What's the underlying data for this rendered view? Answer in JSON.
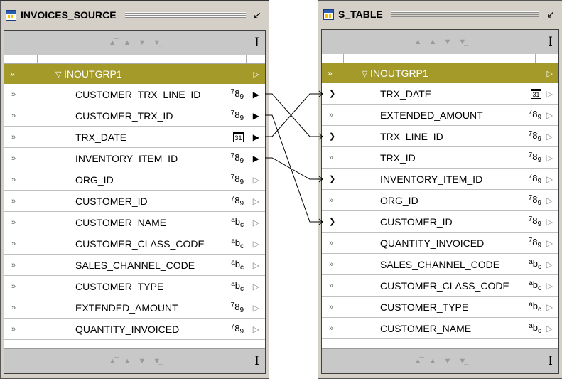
{
  "left": {
    "title": "INVOICES_SOURCE",
    "group": "INOUTGRP1",
    "rows": [
      {
        "name": "CUSTOMER_TRX_LINE_ID",
        "type": "num",
        "linked": true
      },
      {
        "name": "CUSTOMER_TRX_ID",
        "type": "num",
        "linked": true
      },
      {
        "name": "TRX_DATE",
        "type": "date",
        "linked": true
      },
      {
        "name": "INVENTORY_ITEM_ID",
        "type": "num",
        "linked": true
      },
      {
        "name": "ORG_ID",
        "type": "num",
        "linked": false
      },
      {
        "name": "CUSTOMER_ID",
        "type": "num",
        "linked": false
      },
      {
        "name": "CUSTOMER_NAME",
        "type": "str",
        "linked": false
      },
      {
        "name": "CUSTOMER_CLASS_CODE",
        "type": "str",
        "linked": false
      },
      {
        "name": "SALES_CHANNEL_CODE",
        "type": "str",
        "linked": false
      },
      {
        "name": "CUSTOMER_TYPE",
        "type": "str",
        "linked": false
      },
      {
        "name": "EXTENDED_AMOUNT",
        "type": "num",
        "linked": false
      },
      {
        "name": "QUANTITY_INVOICED",
        "type": "num",
        "linked": false
      }
    ]
  },
  "right": {
    "title": "S_TABLE",
    "group": "INOUTGRP1",
    "rows": [
      {
        "name": "TRX_DATE",
        "type": "date",
        "linked": true
      },
      {
        "name": "EXTENDED_AMOUNT",
        "type": "num",
        "linked": false
      },
      {
        "name": "TRX_LINE_ID",
        "type": "num",
        "linked": true
      },
      {
        "name": "TRX_ID",
        "type": "num",
        "linked": false
      },
      {
        "name": "INVENTORY_ITEM_ID",
        "type": "num",
        "linked": true
      },
      {
        "name": "ORG_ID",
        "type": "num",
        "linked": false
      },
      {
        "name": "CUSTOMER_ID",
        "type": "num",
        "linked": true
      },
      {
        "name": "QUANTITY_INVOICED",
        "type": "num",
        "linked": false
      },
      {
        "name": "SALES_CHANNEL_CODE",
        "type": "str",
        "linked": false
      },
      {
        "name": "CUSTOMER_CLASS_CODE",
        "type": "str",
        "linked": false
      },
      {
        "name": "CUSTOMER_TYPE",
        "type": "str",
        "linked": false
      },
      {
        "name": "CUSTOMER_NAME",
        "type": "str",
        "linked": false
      }
    ]
  },
  "type_glyphs": {
    "num": "789",
    "str": "abc",
    "date": "31"
  },
  "icons": {
    "table": "table-icon",
    "minimize": "minimize-icon",
    "text_cursor": "text-cursor-icon",
    "scroll": [
      "scroll-top-icon",
      "scroll-up-icon",
      "scroll-down-icon",
      "scroll-bottom-icon"
    ],
    "expand": "chevron-right-icon",
    "port": "port-flag-icon",
    "group_collapse": "collapse-icon"
  },
  "links": [
    {
      "from": "CUSTOMER_TRX_LINE_ID",
      "to": "TRX_LINE_ID"
    },
    {
      "from": "CUSTOMER_TRX_ID",
      "to": "CUSTOMER_ID"
    },
    {
      "from": "TRX_DATE",
      "to": "TRX_DATE"
    },
    {
      "from": "INVENTORY_ITEM_ID",
      "to": "INVENTORY_ITEM_ID"
    }
  ],
  "colors": {
    "group_bg": "#a39a2a",
    "panel_bg": "#d4d0c8"
  }
}
